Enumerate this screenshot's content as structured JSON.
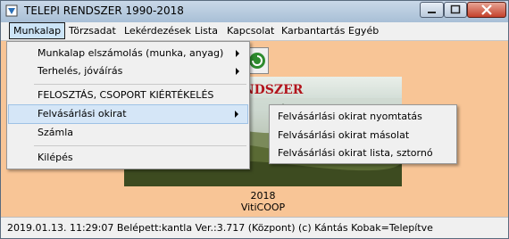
{
  "window": {
    "title": "TELEPI RENDSZER  1990-2018"
  },
  "menubar": [
    "Munkalap",
    "Törzsadat",
    "Lekérdezések",
    "Lista",
    "Kapcsolat",
    "Karbantartás",
    "Egyéb"
  ],
  "dropdown": {
    "items": [
      "Munkalap elszámolás (munka, anyag)",
      "Terhelés, jóváírás",
      "FELOSZTÁS, CSOPORT KIÉRTÉKELÉS",
      "Felvásárlási okirat",
      "Számla",
      "Kilépés"
    ]
  },
  "submenu": {
    "items": [
      "Felvásárlási okirat nyomtatás",
      "Felvásárlási okirat másolat",
      "Felvásárlási okirat lista, sztornó"
    ]
  },
  "banner": {
    "heading": "RENDSZER"
  },
  "footer": {
    "year": "2018",
    "brand": "VitiCOOP"
  },
  "status": {
    "text": "2019.01.13. 11:29:07  Belépett:kantla  Ver.:3.717 (Központ) (c) Kántás Kobak=Telepítve"
  },
  "colors": {
    "background": "#f8c596",
    "highlight": "#d5e6f7",
    "heading": "#b2141c"
  }
}
